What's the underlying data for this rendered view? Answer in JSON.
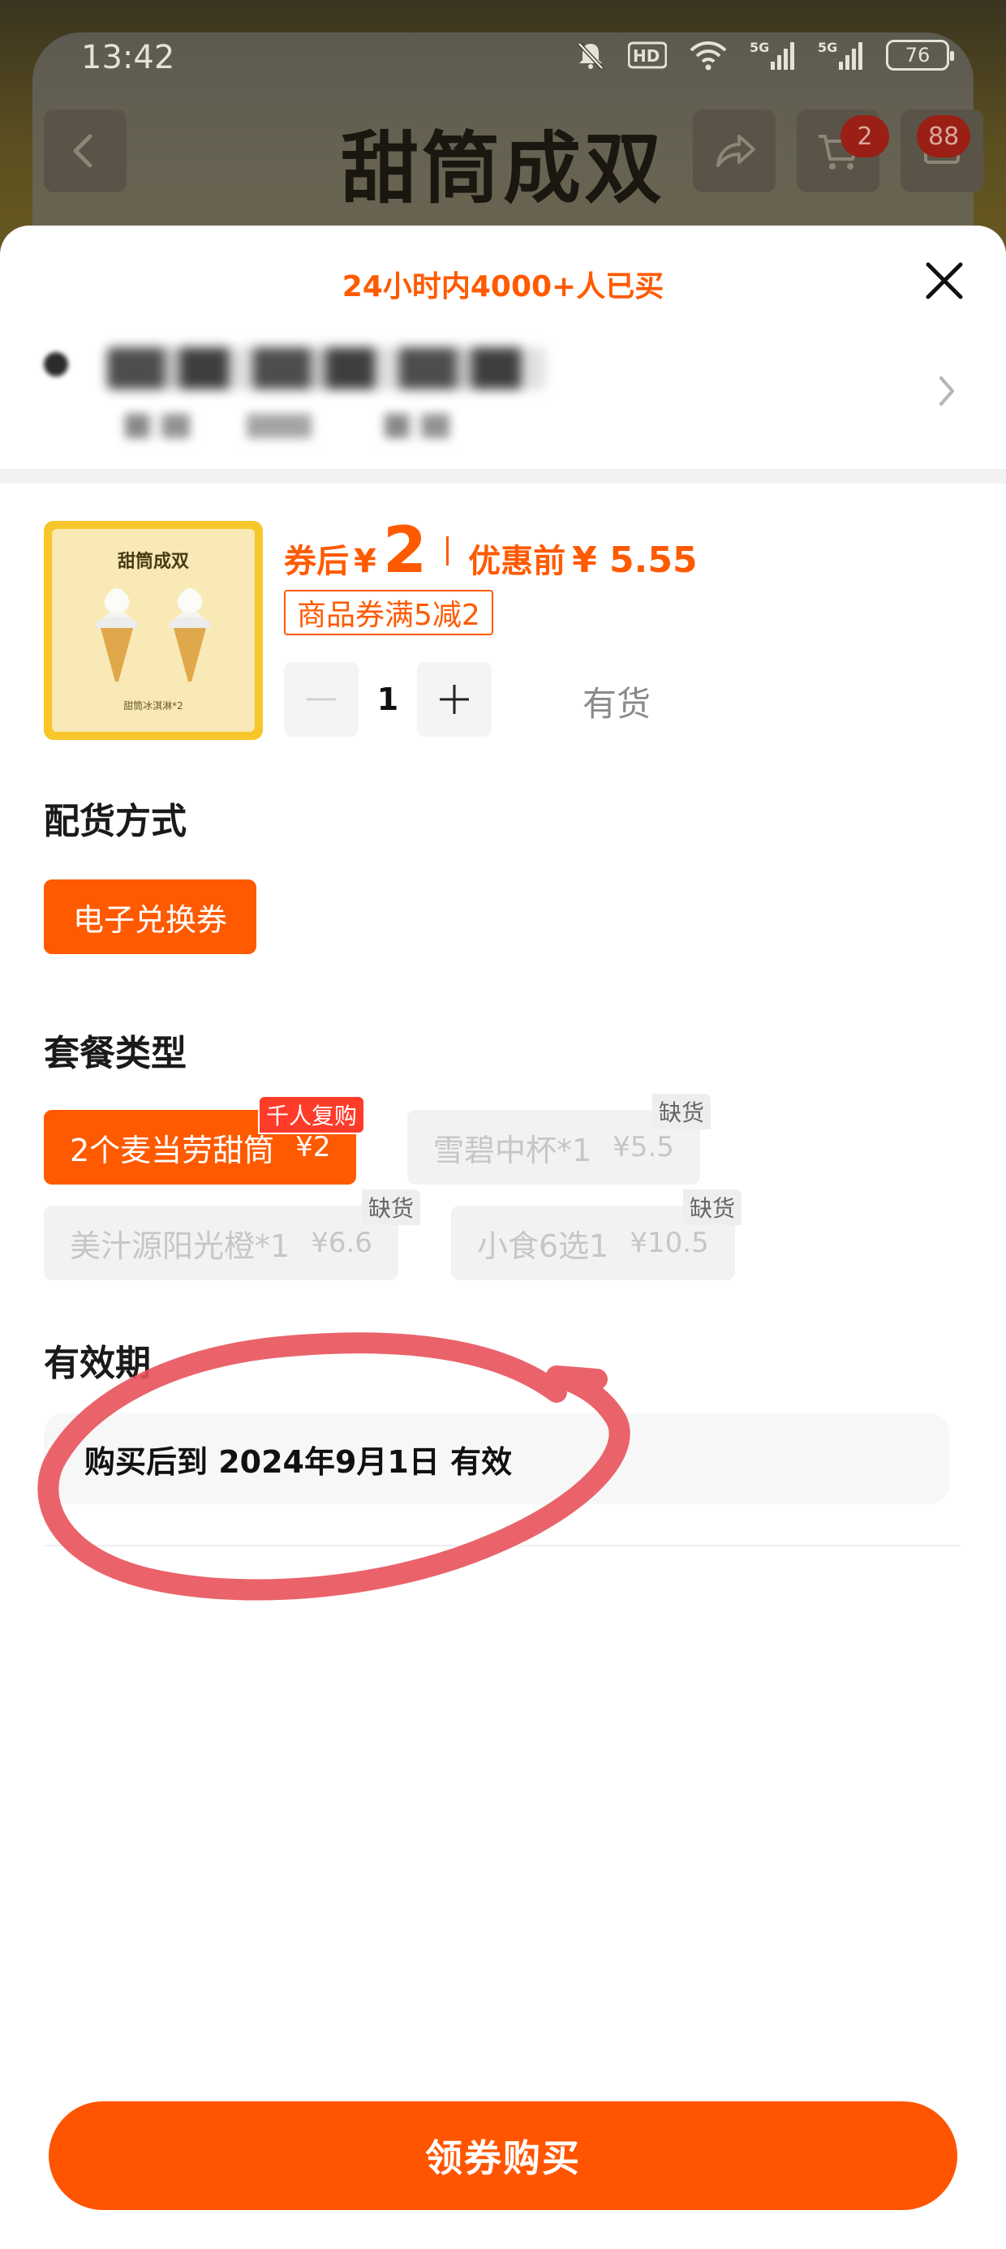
{
  "status_bar": {
    "time": "13:42",
    "battery": "76",
    "icons": [
      "bell-off-icon",
      "hd-icon",
      "wifi-icon",
      "5g-signal-icon",
      "5g-signal-icon",
      "battery-icon"
    ]
  },
  "background_page": {
    "title": "甜筒成双",
    "cart_count": "2",
    "message_count": "88",
    "icons": [
      "back-arrow-icon",
      "share-icon",
      "cart-icon",
      "message-icon"
    ]
  },
  "sheet": {
    "social_proof": "24小时内4000+人已买",
    "close_icon": "close-icon",
    "address": {
      "blurred": true,
      "chevron_icon": "chevron-right-icon"
    },
    "product": {
      "thumbnail_title": "甜筒成双",
      "thumbnail_caption": "甜筒冰淇淋*2",
      "price_label": "券后",
      "currency": "¥",
      "price": "2",
      "original_label": "优惠前",
      "original_price": "¥ 5.55",
      "coupon": "商品券满5减2",
      "quantity": "1",
      "stock_status": "有货"
    },
    "delivery": {
      "title": "配货方式",
      "options": [
        {
          "label": "电子兑换券",
          "selected": true
        }
      ]
    },
    "package": {
      "title": "套餐类型",
      "options": [
        {
          "label": "2个麦当劳甜筒",
          "price": "¥2",
          "tag": "千人复购",
          "selected": true,
          "available": true
        },
        {
          "label": "雪碧中杯*1",
          "price": "¥5.5",
          "tag": "缺货",
          "selected": false,
          "available": false
        },
        {
          "label": "美汁源阳光橙*1",
          "price": "¥6.6",
          "tag": "缺货",
          "selected": false,
          "available": false
        },
        {
          "label": "小食6选1",
          "price": "¥10.5",
          "tag": "缺货",
          "selected": false,
          "available": false
        }
      ]
    },
    "validity": {
      "title": "有效期",
      "text": "购买后到 2024年9月1日 有效"
    },
    "buy_button": "领券购买"
  },
  "colors": {
    "accent": "#ff5a00",
    "buy_button": "#ff5500",
    "hot_tag": "#ff3c2a",
    "annotation_circle": "#e8525a"
  }
}
